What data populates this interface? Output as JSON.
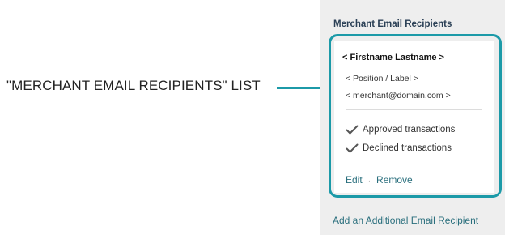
{
  "callout": {
    "label": "\"MERCHANT EMAIL RECIPIENTS\" LIST",
    "accent_color": "#1c9aa8"
  },
  "panel": {
    "title": "Merchant Email Recipients",
    "recipient": {
      "name": "< Firstname Lastname >",
      "position": "< Position / Label >",
      "email": "< merchant@domain.com >",
      "options": [
        {
          "label": "Approved transactions",
          "icon": "checkmark-icon"
        },
        {
          "label": "Declined transactions",
          "icon": "checkmark-icon"
        }
      ],
      "actions": {
        "edit": "Edit",
        "separator": "·",
        "remove": "Remove"
      }
    },
    "add_link": "Add an Additional Email Recipient",
    "link_color": "#2a6f7d"
  }
}
